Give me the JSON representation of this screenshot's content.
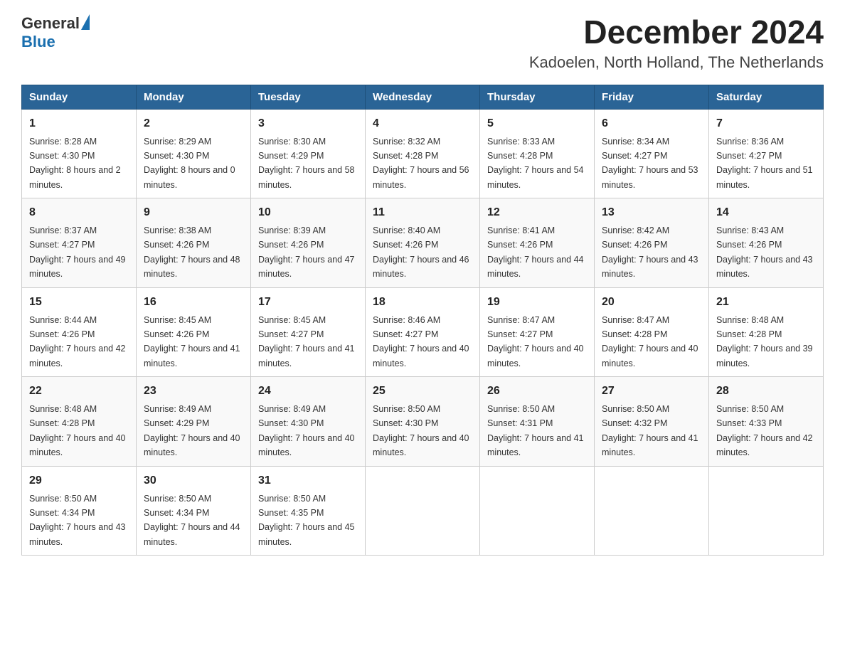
{
  "logo": {
    "general": "General",
    "blue": "Blue"
  },
  "title": "December 2024",
  "subtitle": "Kadoelen, North Holland, The Netherlands",
  "weekdays": [
    "Sunday",
    "Monday",
    "Tuesday",
    "Wednesday",
    "Thursday",
    "Friday",
    "Saturday"
  ],
  "weeks": [
    [
      {
        "day": "1",
        "sunrise": "8:28 AM",
        "sunset": "4:30 PM",
        "daylight": "8 hours and 2 minutes."
      },
      {
        "day": "2",
        "sunrise": "8:29 AM",
        "sunset": "4:30 PM",
        "daylight": "8 hours and 0 minutes."
      },
      {
        "day": "3",
        "sunrise": "8:30 AM",
        "sunset": "4:29 PM",
        "daylight": "7 hours and 58 minutes."
      },
      {
        "day": "4",
        "sunrise": "8:32 AM",
        "sunset": "4:28 PM",
        "daylight": "7 hours and 56 minutes."
      },
      {
        "day": "5",
        "sunrise": "8:33 AM",
        "sunset": "4:28 PM",
        "daylight": "7 hours and 54 minutes."
      },
      {
        "day": "6",
        "sunrise": "8:34 AM",
        "sunset": "4:27 PM",
        "daylight": "7 hours and 53 minutes."
      },
      {
        "day": "7",
        "sunrise": "8:36 AM",
        "sunset": "4:27 PM",
        "daylight": "7 hours and 51 minutes."
      }
    ],
    [
      {
        "day": "8",
        "sunrise": "8:37 AM",
        "sunset": "4:27 PM",
        "daylight": "7 hours and 49 minutes."
      },
      {
        "day": "9",
        "sunrise": "8:38 AM",
        "sunset": "4:26 PM",
        "daylight": "7 hours and 48 minutes."
      },
      {
        "day": "10",
        "sunrise": "8:39 AM",
        "sunset": "4:26 PM",
        "daylight": "7 hours and 47 minutes."
      },
      {
        "day": "11",
        "sunrise": "8:40 AM",
        "sunset": "4:26 PM",
        "daylight": "7 hours and 46 minutes."
      },
      {
        "day": "12",
        "sunrise": "8:41 AM",
        "sunset": "4:26 PM",
        "daylight": "7 hours and 44 minutes."
      },
      {
        "day": "13",
        "sunrise": "8:42 AM",
        "sunset": "4:26 PM",
        "daylight": "7 hours and 43 minutes."
      },
      {
        "day": "14",
        "sunrise": "8:43 AM",
        "sunset": "4:26 PM",
        "daylight": "7 hours and 43 minutes."
      }
    ],
    [
      {
        "day": "15",
        "sunrise": "8:44 AM",
        "sunset": "4:26 PM",
        "daylight": "7 hours and 42 minutes."
      },
      {
        "day": "16",
        "sunrise": "8:45 AM",
        "sunset": "4:26 PM",
        "daylight": "7 hours and 41 minutes."
      },
      {
        "day": "17",
        "sunrise": "8:45 AM",
        "sunset": "4:27 PM",
        "daylight": "7 hours and 41 minutes."
      },
      {
        "day": "18",
        "sunrise": "8:46 AM",
        "sunset": "4:27 PM",
        "daylight": "7 hours and 40 minutes."
      },
      {
        "day": "19",
        "sunrise": "8:47 AM",
        "sunset": "4:27 PM",
        "daylight": "7 hours and 40 minutes."
      },
      {
        "day": "20",
        "sunrise": "8:47 AM",
        "sunset": "4:28 PM",
        "daylight": "7 hours and 40 minutes."
      },
      {
        "day": "21",
        "sunrise": "8:48 AM",
        "sunset": "4:28 PM",
        "daylight": "7 hours and 39 minutes."
      }
    ],
    [
      {
        "day": "22",
        "sunrise": "8:48 AM",
        "sunset": "4:28 PM",
        "daylight": "7 hours and 40 minutes."
      },
      {
        "day": "23",
        "sunrise": "8:49 AM",
        "sunset": "4:29 PM",
        "daylight": "7 hours and 40 minutes."
      },
      {
        "day": "24",
        "sunrise": "8:49 AM",
        "sunset": "4:30 PM",
        "daylight": "7 hours and 40 minutes."
      },
      {
        "day": "25",
        "sunrise": "8:50 AM",
        "sunset": "4:30 PM",
        "daylight": "7 hours and 40 minutes."
      },
      {
        "day": "26",
        "sunrise": "8:50 AM",
        "sunset": "4:31 PM",
        "daylight": "7 hours and 41 minutes."
      },
      {
        "day": "27",
        "sunrise": "8:50 AM",
        "sunset": "4:32 PM",
        "daylight": "7 hours and 41 minutes."
      },
      {
        "day": "28",
        "sunrise": "8:50 AM",
        "sunset": "4:33 PM",
        "daylight": "7 hours and 42 minutes."
      }
    ],
    [
      {
        "day": "29",
        "sunrise": "8:50 AM",
        "sunset": "4:34 PM",
        "daylight": "7 hours and 43 minutes."
      },
      {
        "day": "30",
        "sunrise": "8:50 AM",
        "sunset": "4:34 PM",
        "daylight": "7 hours and 44 minutes."
      },
      {
        "day": "31",
        "sunrise": "8:50 AM",
        "sunset": "4:35 PM",
        "daylight": "7 hours and 45 minutes."
      },
      null,
      null,
      null,
      null
    ]
  ]
}
